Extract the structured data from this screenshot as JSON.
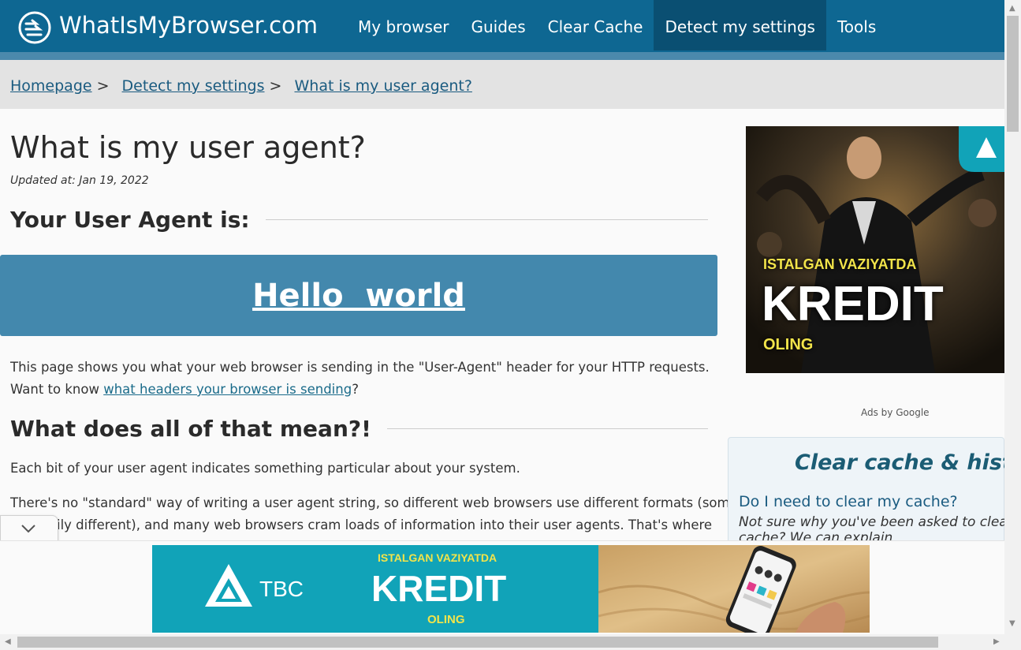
{
  "header": {
    "brand": "WhatIsMyBrowser.com",
    "nav": [
      {
        "label": "My browser"
      },
      {
        "label": "Guides"
      },
      {
        "label": "Clear Cache"
      },
      {
        "label": "Detect my settings",
        "active": true
      },
      {
        "label": "Tools"
      }
    ]
  },
  "breadcrumb": {
    "items": [
      "Homepage",
      "Detect my settings",
      "What is my user agent?"
    ],
    "separator": ">"
  },
  "main": {
    "title": "What is my user agent?",
    "updated": "Updated at: Jan 19, 2022",
    "ua_heading": "Your User Agent is:",
    "ua_value": "Hello  world",
    "para1_a": "This page shows you what your web browser is sending in the \"User-Agent\" header for your HTTP requests.",
    "para1_b": "Want to know ",
    "para1_link": "what headers your browser is sending",
    "para1_end": "?",
    "meaning_heading": "What does all of that mean?!",
    "para2": "Each bit of your user agent indicates something particular about your system.",
    "para3_line1": "There's no \"standard\" way of writing a user agent string, so different web browsers use different formats (some",
    "para3_line2": "ily different), and many web browsers cram loads of information into their user agents. That's where"
  },
  "sidebar": {
    "ad": {
      "line1": "ISTALGAN VAZIYATDA",
      "line2": "KREDIT",
      "line3": "OLING"
    },
    "ads_by": "Ads by Google",
    "cache_box": {
      "title": "Clear cache & history",
      "question": "Do I need to clear my cache?",
      "desc_line1": "Not sure why you've been asked to clear you",
      "desc_line2": "cache? We can explain"
    }
  },
  "bottom_ad": {
    "brand": "TBC",
    "line1": "ISTALGAN VAZIYATDA",
    "line2": "KREDIT",
    "line3": "OLING"
  },
  "colors": {
    "nav_bg": "#0e6792",
    "ua_box": "#4388ad",
    "ad_teal": "#11a3b8"
  }
}
